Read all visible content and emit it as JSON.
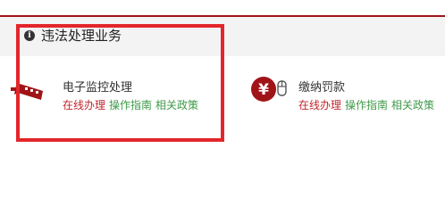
{
  "section": {
    "title": "违法处理业务"
  },
  "cards": [
    {
      "title": "电子监控处理",
      "links": [
        "在线办理",
        "操作指南",
        "相关政策"
      ]
    },
    {
      "title": "缴纳罚款",
      "links": [
        "在线办理",
        "操作指南",
        "相关政策"
      ]
    }
  ],
  "colors": {
    "brand_red": "#a01418",
    "highlight_red": "#e3262b",
    "link_red": "#c0272d",
    "link_green": "#3f9a49"
  },
  "icons": {
    "header": "info-icon",
    "card_1": "surveillance-camera-icon",
    "card_2": "yuan-payment-icon"
  }
}
